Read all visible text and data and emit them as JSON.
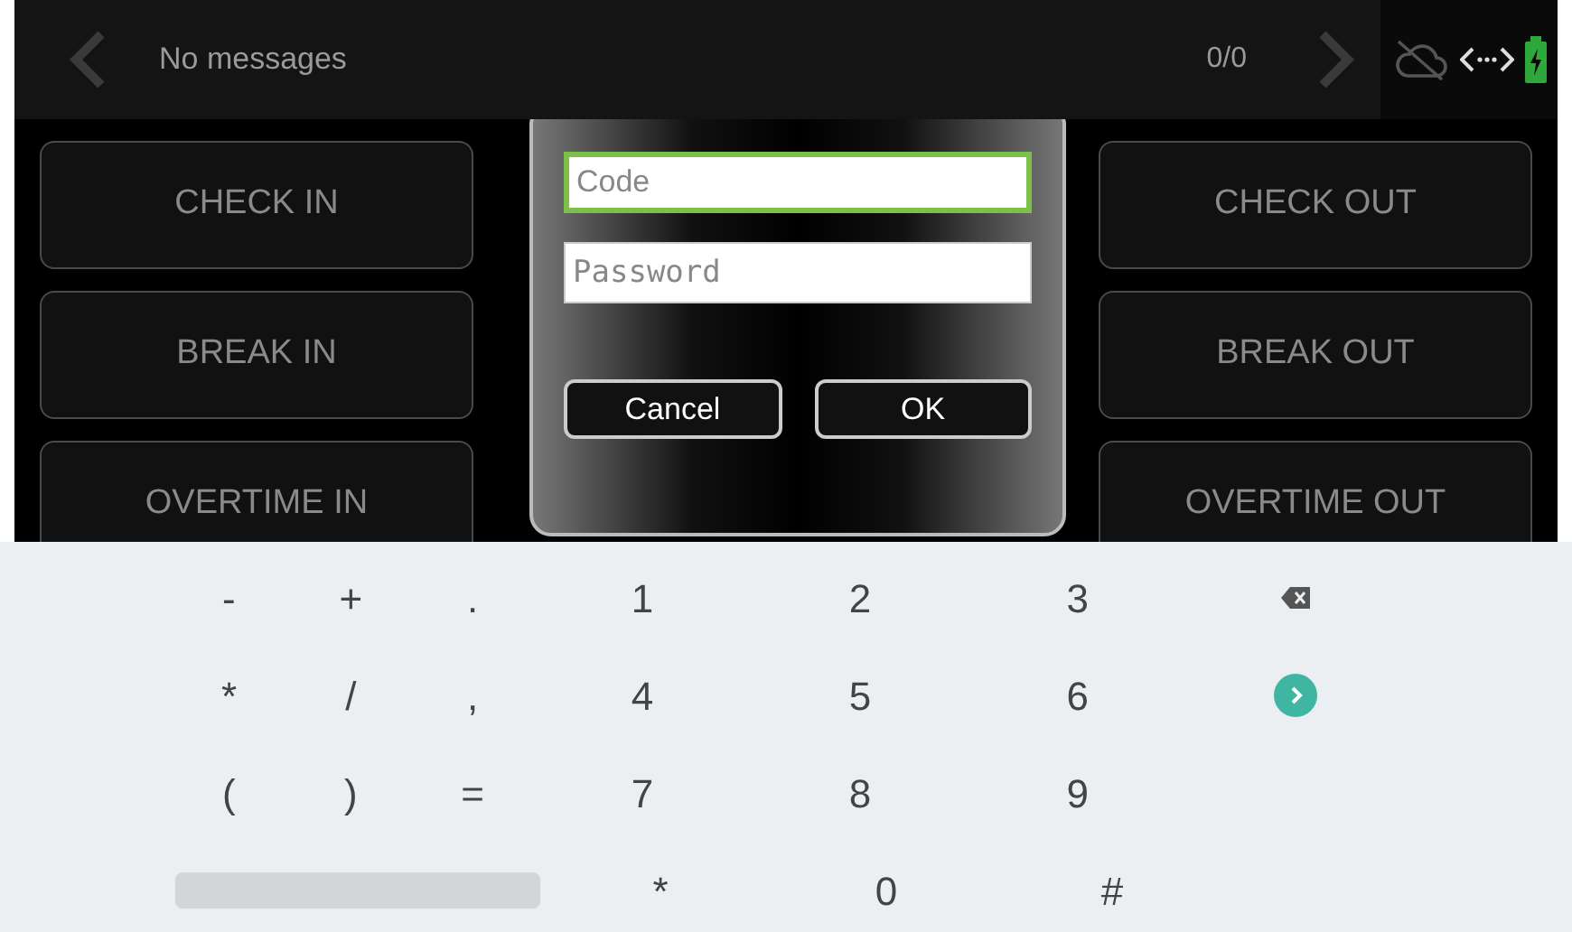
{
  "message_bar": {
    "text": "No messages",
    "counter": "0/0"
  },
  "left_buttons": [
    "CHECK IN",
    "BREAK IN",
    "OVERTIME IN"
  ],
  "right_buttons": [
    "CHECK OUT",
    "BREAK OUT",
    "OVERTIME OUT"
  ],
  "dialog": {
    "fields": [
      {
        "placeholder": "Code",
        "focused": true,
        "mono": false
      },
      {
        "placeholder": "Password",
        "focused": false,
        "mono": true
      }
    ],
    "buttons": [
      "Cancel",
      "OK"
    ]
  },
  "keyboard": {
    "rows": [
      [
        "-",
        "+",
        ".",
        "1",
        "2",
        "3",
        {
          "kind": "backspace"
        }
      ],
      [
        "*",
        "/",
        ",",
        "4",
        "5",
        "6",
        {
          "kind": "go"
        }
      ],
      [
        "(",
        ")",
        "=",
        "7",
        "8",
        "9",
        {
          "kind": "empty"
        }
      ],
      [
        {
          "kind": "space"
        },
        "*",
        "0",
        "#"
      ]
    ]
  }
}
